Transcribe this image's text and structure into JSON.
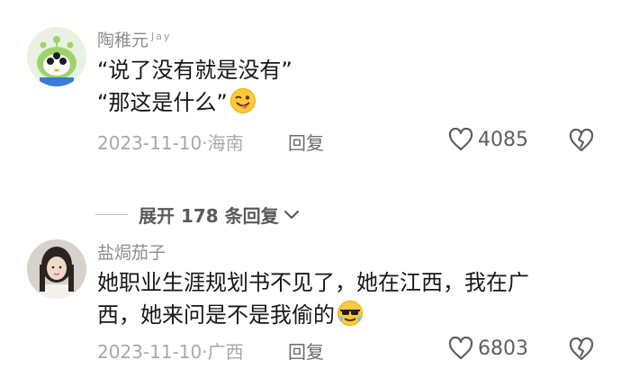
{
  "comments": [
    {
      "username": "陶稚元",
      "username_sup": "Jay",
      "lines": [
        "“说了没有就是没有”",
        "“那这是什么”"
      ],
      "emoji": "winking-tongue-emoji",
      "date": "2023-11-10",
      "location": "海南",
      "reply_label": "回复",
      "likes": "4085"
    },
    {
      "username": "盐焗茄子",
      "lines": [
        "她职业生涯规划书不见了，她在江西，我在广",
        "西，她来问是不是我偷的"
      ],
      "emoji": "sunglasses-emoji",
      "date": "2023-11-10",
      "location": "广西",
      "reply_label": "回复",
      "likes": "6803"
    }
  ],
  "expand_replies": {
    "label": "展开 178 条回复"
  },
  "colors": {
    "text": "#161616",
    "meta": "#a8a8a8",
    "username": "#8c8c8c",
    "action": "#5e5e5e"
  }
}
